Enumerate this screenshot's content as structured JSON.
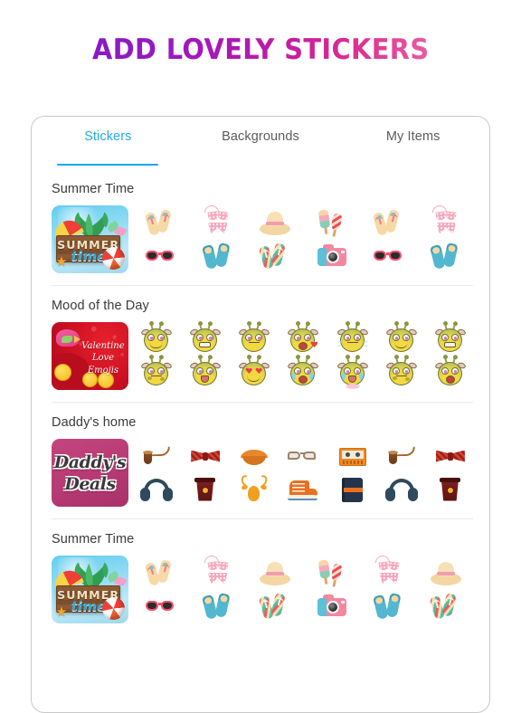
{
  "header": {
    "title": "ADD LOVELY STICKERS",
    "gradient_start": "#8B19C6",
    "gradient_end": "#E95BA4"
  },
  "tabs": {
    "active_index": 0,
    "active_color": "#24ace0",
    "inactive_color": "#5c5c5c",
    "underline_color": "#17a9ef",
    "items": [
      {
        "label": "Stickers"
      },
      {
        "label": "Backgrounds"
      },
      {
        "label": "My Items"
      }
    ]
  },
  "sections": [
    {
      "title": "Summer Time",
      "thumbnail": {
        "kind": "summer",
        "line1": "SUMMER",
        "line2": "time"
      },
      "columns": 6,
      "stickers": [
        "flipflops-sticker",
        "bikini-sticker",
        "sunhat-sticker",
        "popsicle-sticker",
        "flipflops-sticker",
        "bikini-sticker",
        "sunglasses-sticker",
        "flippers-sticker",
        "flipflops-striped-sticker",
        "camera-sticker",
        "sunglasses-sticker",
        "flippers-sticker"
      ]
    },
    {
      "title": "Mood of the Day",
      "thumbnail": {
        "kind": "valentine",
        "line1": "Valentine",
        "line2": "Love Emojis"
      },
      "columns": 7,
      "stickers": [
        "giraffe-smile-sticker",
        "giraffe-teeth-sticker",
        "giraffe-wink-sticker",
        "giraffe-kiss-sticker",
        "giraffe-steam-sticker",
        "giraffe-smile-sticker",
        "giraffe-teeth-sticker",
        "giraffe-spots-sticker",
        "giraffe-shock-sticker",
        "giraffe-love-sticker",
        "giraffe-laugh-sticker",
        "giraffe-tongue-sticker",
        "giraffe-spots-sticker",
        "giraffe-shock-sticker"
      ]
    },
    {
      "title": "Daddy's home",
      "thumbnail": {
        "kind": "daddy",
        "line1": "Daddy's",
        "line2": "Deals"
      },
      "columns": 7,
      "stickers": [
        "pipe-sticker",
        "bowtie-sticker",
        "lips-sticker",
        "glasses-sticker",
        "cassette-sticker",
        "pipe-sticker",
        "bowtie-sticker",
        "headphones-sticker",
        "coffee-sticker",
        "deer-sticker",
        "sneaker-sticker",
        "notebook-sticker",
        "headphones-sticker",
        "coffee-sticker"
      ]
    },
    {
      "title": "Summer Time",
      "thumbnail": {
        "kind": "summer",
        "line1": "SUMMER",
        "line2": "time"
      },
      "columns": 5,
      "stickers": [
        "flipflops-sticker",
        "bikini-sticker",
        "sunhat-sticker",
        "popsicle-bikini-sticker",
        "sunhat-sticker",
        "sunglasses-sticker",
        "flippers-sticker",
        "flipflops-striped-sticker",
        "camera-flippers-sticker",
        "flipflops-striped-sticker"
      ]
    }
  ]
}
